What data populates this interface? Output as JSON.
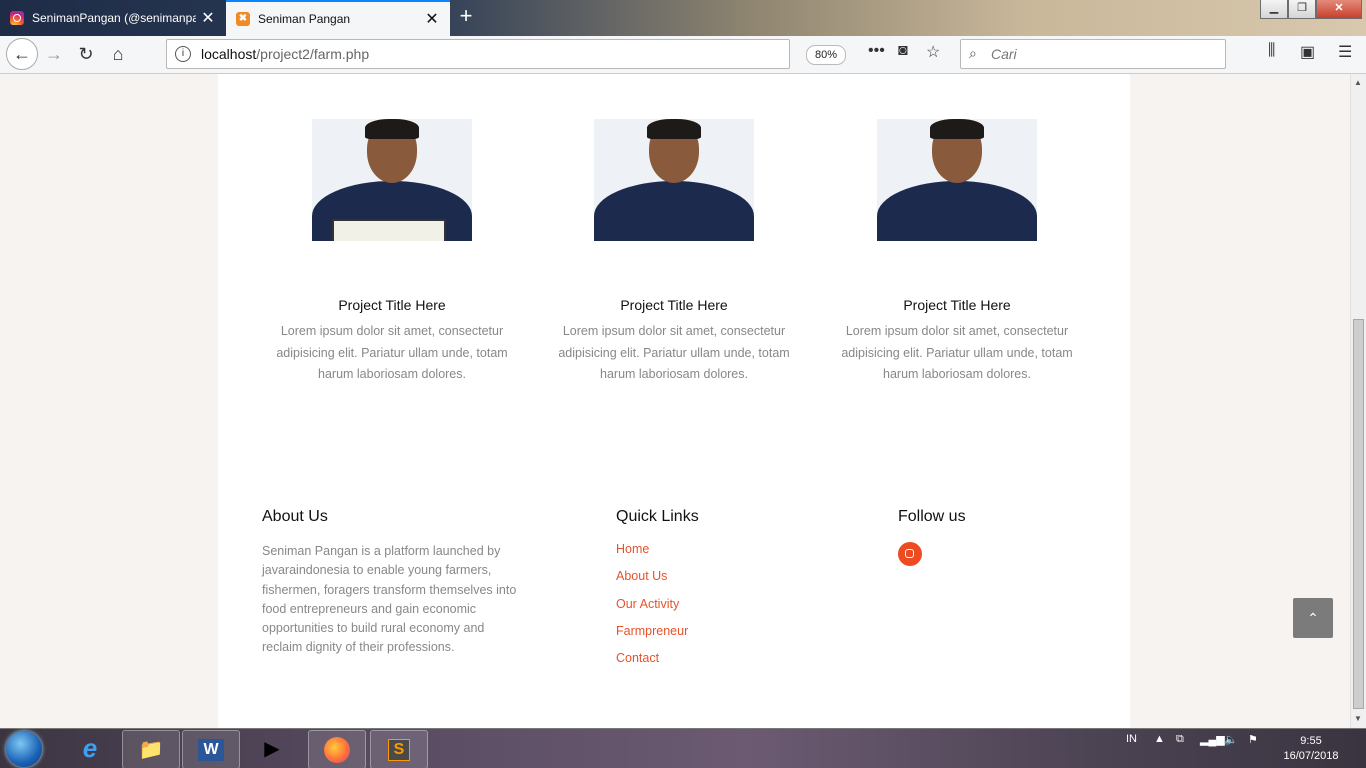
{
  "browser": {
    "tabs": [
      {
        "title": "SenimanPangan (@senimanpa",
        "icon": "instagram-icon",
        "active": false
      },
      {
        "title": "Seniman Pangan",
        "icon": "xampp-icon",
        "active": true
      }
    ],
    "url_host": "localhost",
    "url_path": "/project2/farm.php",
    "zoom": "80%",
    "search_placeholder": "Cari"
  },
  "projects": [
    {
      "title": "Project Title Here",
      "desc": "Lorem ipsum dolor sit amet, consectetur adipisicing elit. Pariatur ullam unde, totam harum laboriosam dolores."
    },
    {
      "title": "Project Title Here",
      "desc": "Lorem ipsum dolor sit amet, consectetur adipisicing elit. Pariatur ullam unde, totam harum laboriosam dolores."
    },
    {
      "title": "Project Title Here",
      "desc": "Lorem ipsum dolor sit amet, consectetur adipisicing elit. Pariatur ullam unde, totam harum laboriosam dolores."
    }
  ],
  "footer": {
    "about_title": "About Us",
    "about_text": "Seniman Pangan is a platform launched by javaraindonesia to enable young farmers, fishermen, foragers transform themselves into food entrepreneurs and gain economic opportunities to build rural economy and reclaim dignity of their professions.",
    "links_title": "Quick Links",
    "links": [
      "Home",
      "About Us",
      "Our Activity",
      "Farmpreneur",
      "Contact"
    ],
    "follow_title": "Follow us",
    "social_icon": "instagram-icon",
    "accent_color": "#e5532d"
  },
  "taskbar": {
    "language": "IN",
    "time": "9:55",
    "date": "16/07/2018"
  }
}
